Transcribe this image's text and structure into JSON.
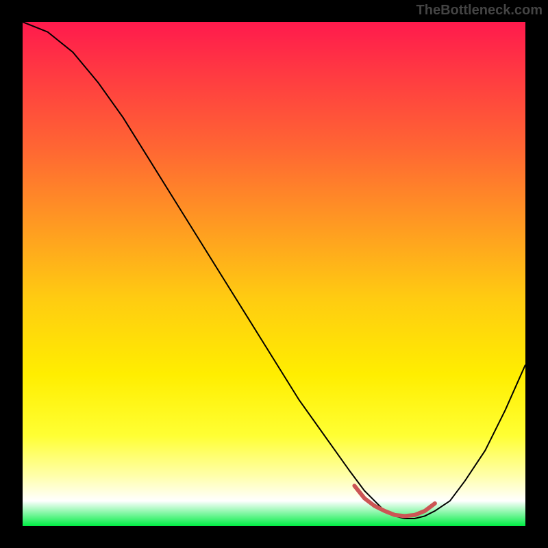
{
  "watermark": "TheBottleneck.com",
  "chart_data": {
    "type": "line",
    "title": "",
    "xlabel": "",
    "ylabel": "",
    "xlim": [
      0,
      100
    ],
    "ylim": [
      0,
      100
    ],
    "series": [
      {
        "name": "bottleneck-curve",
        "x": [
          0,
          5,
          10,
          15,
          20,
          25,
          30,
          35,
          40,
          45,
          50,
          55,
          60,
          65,
          68,
          70,
          72,
          74,
          76,
          78,
          80,
          82,
          85,
          88,
          92,
          96,
          100
        ],
        "y": [
          100,
          98,
          94,
          88,
          81,
          73,
          65,
          57,
          49,
          41,
          33,
          25,
          18,
          11,
          7,
          5,
          3,
          2,
          1.5,
          1.5,
          2,
          3,
          5,
          9,
          15,
          23,
          32
        ],
        "color": "#000000"
      },
      {
        "name": "optimal-zone",
        "x": [
          66,
          68,
          70,
          72,
          74,
          76,
          78,
          80,
          82
        ],
        "y": [
          8,
          5.5,
          4,
          3,
          2.2,
          2,
          2.2,
          3,
          4.5
        ],
        "color": "#cc5555"
      }
    ],
    "gradient_stops": [
      {
        "pos": 0,
        "color": "#ff1a4d"
      },
      {
        "pos": 25,
        "color": "#ff6633"
      },
      {
        "pos": 55,
        "color": "#ffcc11"
      },
      {
        "pos": 82,
        "color": "#ffff33"
      },
      {
        "pos": 100,
        "color": "#00ee44"
      }
    ]
  }
}
